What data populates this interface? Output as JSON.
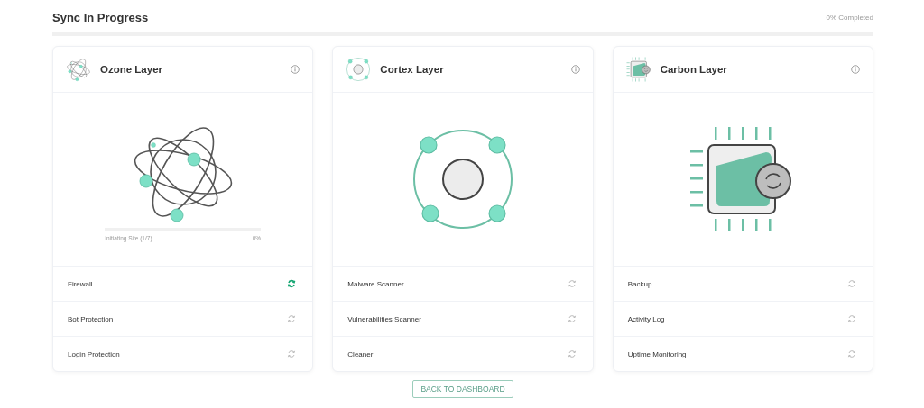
{
  "header": {
    "title": "Sync In Progress",
    "status": "0% Completed",
    "level": 0
  },
  "cards": [
    {
      "kind": "atom",
      "title": "Ozone Layer",
      "progress": {
        "label": "Initiating Site (1/7)",
        "reading": "0%",
        "level": 0
      },
      "tasks": [
        {
          "label": "Firewall",
          "active": true
        },
        {
          "label": "Bot Protection",
          "active": false
        },
        {
          "label": "Login Protection",
          "active": false
        }
      ]
    },
    {
      "kind": "ring",
      "title": "Cortex Layer",
      "tasks": [
        {
          "label": "Malware Scanner",
          "active": false
        },
        {
          "label": "Vulnerabilities Scanner",
          "active": false
        },
        {
          "label": "Cleaner",
          "active": false
        }
      ]
    },
    {
      "kind": "chip",
      "title": "Carbon Layer",
      "tasks": [
        {
          "label": "Backup",
          "active": false
        },
        {
          "label": "Activity Log",
          "active": false
        },
        {
          "label": "Uptime Monitoring",
          "active": false
        }
      ]
    }
  ],
  "button": "BACK TO DASHBOARD"
}
